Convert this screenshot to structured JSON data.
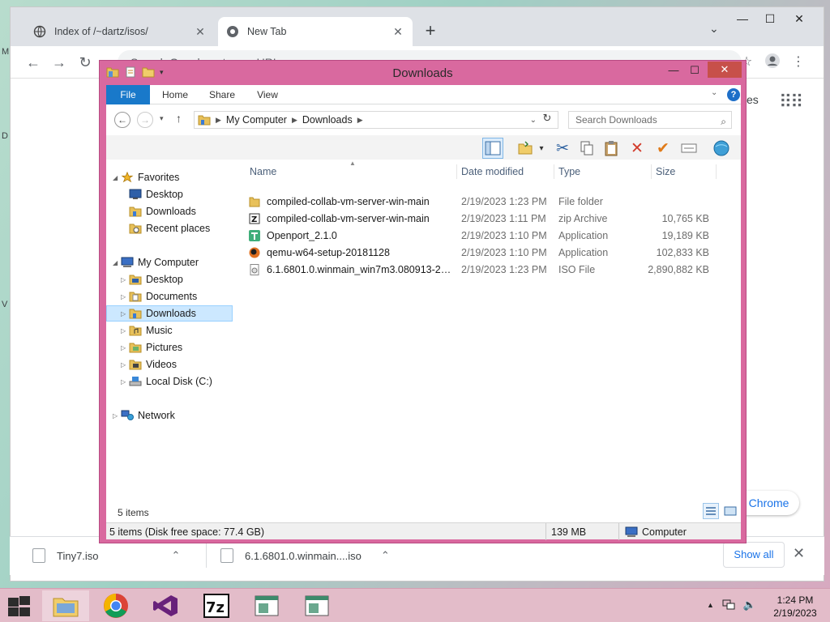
{
  "chrome": {
    "tabs": [
      {
        "label": "Index of /~dartz/isos/",
        "icon": "globe-icon"
      },
      {
        "label": "New Tab",
        "icon": "chrome-icon"
      }
    ],
    "omnibox_placeholder": "Search Google or type a URL",
    "partial_right_text": "es",
    "promo_pill": "e Chrome",
    "left_edge_glyphs": [
      "M",
      "D",
      "V"
    ]
  },
  "downloads_shelf": {
    "items": [
      {
        "name": "Tiny7.iso"
      },
      {
        "name": "6.1.6801.0.winmain....iso"
      }
    ],
    "show_all": "Show all"
  },
  "explorer": {
    "title": "Downloads",
    "ribbon_tabs": [
      "File",
      "Home",
      "Share",
      "View"
    ],
    "help": "?",
    "breadcrumb": [
      "My Computer",
      "Downloads"
    ],
    "search_placeholder": "Search Downloads",
    "tree": [
      {
        "label": "Favorites",
        "icon": "star-icon",
        "level": 0,
        "expander": "open"
      },
      {
        "label": "Desktop",
        "icon": "desktop-icon",
        "level": 1,
        "expander": ""
      },
      {
        "label": "Downloads",
        "icon": "downloads-folder-icon",
        "level": 1,
        "expander": ""
      },
      {
        "label": "Recent places",
        "icon": "recent-places-icon",
        "level": 1,
        "expander": ""
      },
      {
        "label": "My Computer",
        "icon": "computer-icon",
        "level": 0,
        "expander": "open"
      },
      {
        "label": "Desktop",
        "icon": "desktop-icon",
        "level": 1,
        "expander": "closed"
      },
      {
        "label": "Documents",
        "icon": "documents-icon",
        "level": 1,
        "expander": "closed"
      },
      {
        "label": "Downloads",
        "icon": "downloads-folder-icon",
        "level": 1,
        "expander": "closed",
        "selected": true
      },
      {
        "label": "Music",
        "icon": "music-icon",
        "level": 1,
        "expander": "closed"
      },
      {
        "label": "Pictures",
        "icon": "pictures-icon",
        "level": 1,
        "expander": "closed"
      },
      {
        "label": "Videos",
        "icon": "videos-icon",
        "level": 1,
        "expander": "closed"
      },
      {
        "label": "Local Disk (C:)",
        "icon": "drive-icon",
        "level": 1,
        "expander": "closed"
      },
      {
        "label": "Network",
        "icon": "network-icon",
        "level": 0,
        "expander": "closed"
      }
    ],
    "columns": [
      "Name",
      "Date modified",
      "Type",
      "Size"
    ],
    "files": [
      {
        "name": "compiled-collab-vm-server-win-main",
        "date": "2/19/2023 1:23 PM",
        "type": "File folder",
        "size": "",
        "icon": "folder-icon"
      },
      {
        "name": "compiled-collab-vm-server-win-main",
        "date": "2/19/2023 1:11 PM",
        "type": "zip Archive",
        "size": "10,765 KB",
        "icon": "7zip-archive-icon"
      },
      {
        "name": "Openport_2.1.0",
        "date": "2/19/2023 1:10 PM",
        "type": "Application",
        "size": "19,189 KB",
        "icon": "openport-app-icon"
      },
      {
        "name": "qemu-w64-setup-20181128",
        "date": "2/19/2023 1:10 PM",
        "type": "Application",
        "size": "102,833 KB",
        "icon": "qemu-app-icon"
      },
      {
        "name": "6.1.6801.0.winmain_win7m3.080913-2030...",
        "date": "2/19/2023 1:23 PM",
        "type": "ISO File",
        "size": "2,890,882 KB",
        "icon": "iso-file-icon"
      }
    ],
    "item_count": "5 items",
    "status": {
      "left": "5 items (Disk free space: 77.4 GB)",
      "size": "139 MB",
      "location": "Computer"
    }
  },
  "taskbar": {
    "clock_time": "1:24 PM",
    "clock_date": "2/19/2023"
  },
  "colors": {
    "explorer_frame": "#d9699f",
    "file_tab": "#1979ca",
    "selection": "#cce8ff",
    "taskbar": "#e3bcc9"
  }
}
